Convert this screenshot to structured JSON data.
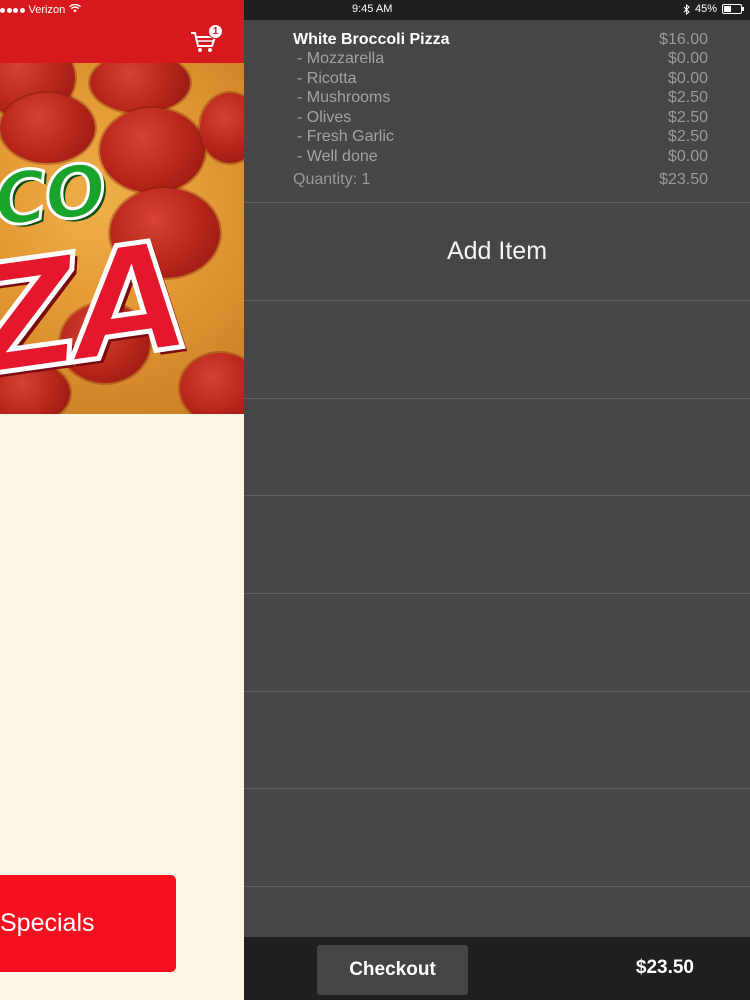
{
  "status_bar": {
    "carrier": "Verizon",
    "time": "9:45 AM",
    "battery_text": "45%",
    "battery_level": 0.45,
    "icons": [
      "signal-dots-icon",
      "wifi-icon",
      "bluetooth-icon",
      "battery-icon"
    ]
  },
  "header": {
    "cart_icon": "cart-icon",
    "cart_count": "1",
    "accent_color": "#d7181c"
  },
  "hero": {
    "logo_text_top": "CO",
    "logo_text_bottom": "ZA"
  },
  "specials_button": {
    "label": "Specials"
  },
  "cart": {
    "item": {
      "name": "White Broccoli Pizza",
      "price": "$16.00",
      "modifiers": [
        {
          "name": "- Mozzarella",
          "price": "$0.00"
        },
        {
          "name": "- Ricotta",
          "price": "$0.00"
        },
        {
          "name": "- Mushrooms",
          "price": "$2.50"
        },
        {
          "name": "- Olives",
          "price": "$2.50"
        },
        {
          "name": "- Fresh Garlic",
          "price": "$2.50"
        },
        {
          "name": "- Well done",
          "price": "$0.00"
        }
      ],
      "quantity_label": "Quantity: 1",
      "line_total": "$23.50"
    },
    "add_item_label": "Add Item",
    "checkout_label": "Checkout",
    "total": "$23.50"
  }
}
